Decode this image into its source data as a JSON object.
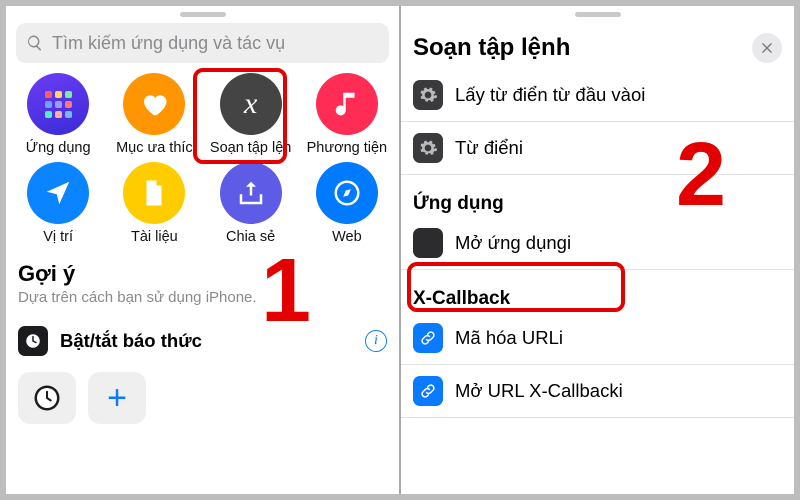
{
  "left": {
    "search_placeholder": "Tìm kiếm ứng dụng và tác vụ",
    "categories": [
      {
        "label": "Ứng dụng"
      },
      {
        "label": "Mục ưa thíc"
      },
      {
        "label": "Soạn tập lện"
      },
      {
        "label": "Phương tiện"
      },
      {
        "label": "Vị trí"
      },
      {
        "label": "Tài liệu"
      },
      {
        "label": "Chia sẻ"
      },
      {
        "label": "Web"
      }
    ],
    "suggestions_header": "Gợi ý",
    "suggestions_sub": "Dựa trên cách bạn sử dụng iPhone.",
    "suggestion_row": "Bật/tắt báo thức",
    "step": "1"
  },
  "right": {
    "title": "Soạn tập lệnh",
    "rows_top": [
      {
        "label": "Lấy từ điển từ đầu vào"
      },
      {
        "label": "Từ điển"
      }
    ],
    "section_apps": "Ứng dụng",
    "open_app_row": "Mở ứng dụng",
    "section_xcb": "X-Callback",
    "xcb_rows": [
      {
        "label": "Mã hóa URL"
      },
      {
        "label": "Mở URL X-Callback"
      }
    ],
    "step": "2"
  }
}
